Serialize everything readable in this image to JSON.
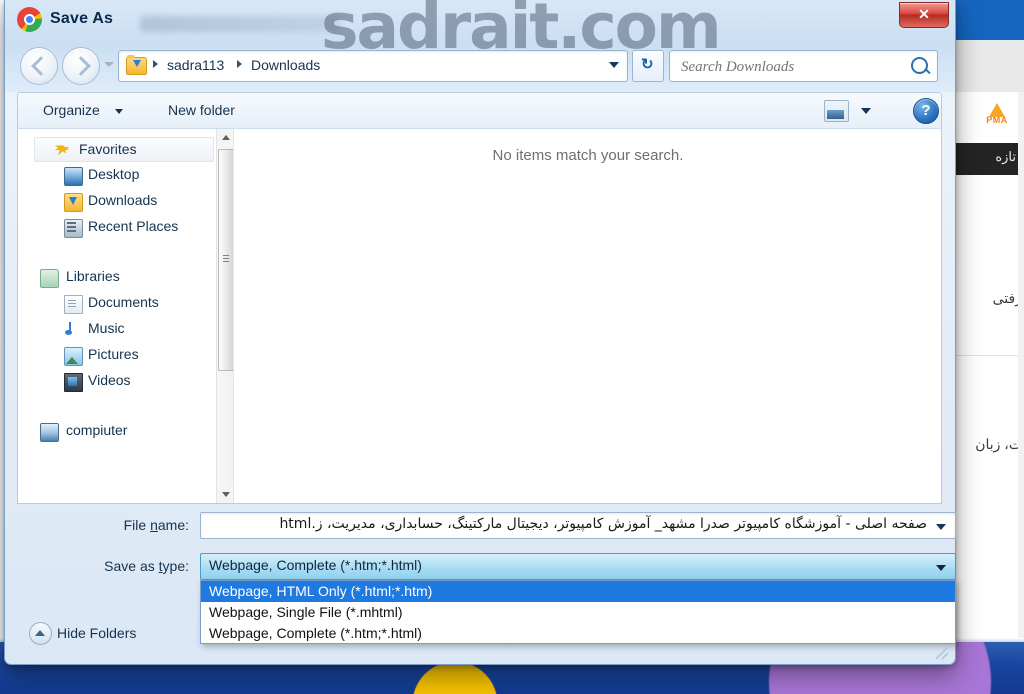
{
  "window": {
    "title": "Save As",
    "app_icon": "chrome-icon",
    "close_label": "✕",
    "watermark": "sadrait.com"
  },
  "nav": {
    "back_tooltip": "Back",
    "forward_tooltip": "Forward",
    "breadcrumbs": [
      "sadra113",
      "Downloads"
    ],
    "refresh_glyph": "↻",
    "search": {
      "placeholder": "Search Downloads",
      "value": ""
    }
  },
  "toolbar": {
    "organize_label": "Organize",
    "new_folder_label": "New folder",
    "help_label": "?"
  },
  "sidebar": {
    "items": [
      {
        "label": "Favorites",
        "icon": "star-icon",
        "level": 0,
        "selected": true
      },
      {
        "label": "Desktop",
        "icon": "desktop-icon",
        "level": 1,
        "selected": false
      },
      {
        "label": "Downloads",
        "icon": "downloads-folder-icon",
        "level": 1,
        "selected": false
      },
      {
        "label": "Recent Places",
        "icon": "recent-places-icon",
        "level": 1,
        "selected": false
      },
      {
        "label": "Libraries",
        "icon": "libraries-folder-icon",
        "level": 0,
        "selected": false
      },
      {
        "label": "Documents",
        "icon": "document-icon",
        "level": 1,
        "selected": false
      },
      {
        "label": "Music",
        "icon": "music-note-icon",
        "level": 1,
        "selected": false
      },
      {
        "label": "Pictures",
        "icon": "picture-icon",
        "level": 1,
        "selected": false
      },
      {
        "label": "Videos",
        "icon": "video-icon",
        "level": 1,
        "selected": false
      },
      {
        "label": "compiuter",
        "icon": "computer-icon",
        "level": 0,
        "selected": false
      }
    ]
  },
  "file_list": {
    "empty_message": "No items match your search."
  },
  "form": {
    "file_name_label": "File name:",
    "file_name_value": "صفحه اصلی - آموزشگاه کامپیوتر صدرا مشهد_ آموزش کامپیوتر، دیجیتال مارکتینگ، حسابداری، مدیریت، ز.html",
    "save_as_type_label": "Save as type:",
    "save_as_type_value": "Webpage, Complete (*.htm;*.html)",
    "save_as_type_options": [
      {
        "label": "Webpage, HTML Only (*.html;*.htm)",
        "selected": true
      },
      {
        "label": "Webpage, Single File (*.mhtml)",
        "selected": false
      },
      {
        "label": "Webpage, Complete (*.htm;*.html)",
        "selected": false
      }
    ],
    "hide_folders_label": "Hide Folders"
  },
  "background": {
    "site_logo": "PMA",
    "nav_item": "تازه",
    "text_fragment_1": "رفتی",
    "text_fragment_2": "ت، زبان"
  },
  "colors": {
    "accent_blue": "#1e7ae0",
    "close_red": "#d9453c",
    "combo_selected": "#a9ddf2",
    "title_text": "#0b2a4a",
    "wallpaper_blue": "#1b47a0",
    "wallpaper_yellow": "#f6c200",
    "logo_orange": "#f08322"
  }
}
